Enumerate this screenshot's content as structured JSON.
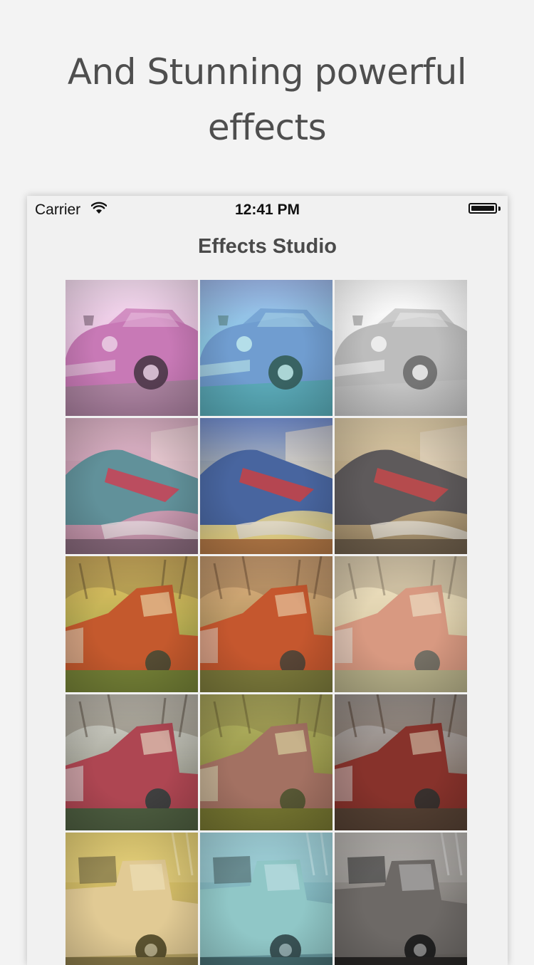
{
  "headline": "And Stunning powerful effects",
  "status_bar": {
    "carrier": "Carrier",
    "time": "12:41 PM",
    "wifi_icon": "wifi-icon",
    "battery_icon": "battery-icon",
    "battery_level": 1.0
  },
  "nav": {
    "title": "Effects Studio"
  },
  "effects": [
    {
      "row": 1,
      "col": 1,
      "subject": "vintage-sedan",
      "bg": [
        "#ffffff",
        "#d8b6d0"
      ],
      "body": "#c27ab0",
      "ground": "#7a6a72",
      "tint": "rgba(220,120,200,0.25)"
    },
    {
      "row": 1,
      "col": 2,
      "subject": "vintage-sedan",
      "bg": [
        "#b7a3e8",
        "#8fe0e6"
      ],
      "body": "#7a7fc7",
      "ground": "#3f6d83",
      "tint": "rgba(90,230,230,0.30)"
    },
    {
      "row": 1,
      "col": 3,
      "subject": "vintage-sedan",
      "bg": [
        "#ffffff",
        "#d3d3d3"
      ],
      "body": "#9a9a9a",
      "ground": "#8a8a8a",
      "tint": "rgba(255,255,255,0.35)"
    },
    {
      "row": 2,
      "col": 1,
      "subject": "tailfin-car",
      "bg": [
        "#caa8b8",
        "#b48a9f"
      ],
      "body": "#3f8a8e",
      "ground": "#6a5664",
      "tint": "rgba(255,180,210,0.18)"
    },
    {
      "row": 2,
      "col": 2,
      "subject": "tailfin-car",
      "bg": [
        "#4c77d9",
        "#f3dd7c"
      ],
      "body": "#2953a6",
      "ground": "#a0663b",
      "tint": "rgba(255,210,120,0.15)"
    },
    {
      "row": 2,
      "col": 3,
      "subject": "tailfin-car",
      "bg": [
        "#d9c9a7",
        "#8f7b5d"
      ],
      "body": "#3b3e4e",
      "ground": "#4e4238",
      "tint": "rgba(220,190,140,0.22)"
    },
    {
      "row": 3,
      "col": 1,
      "subject": "rusty-truck",
      "bg": [
        "#e6c36a",
        "#6d8a3a"
      ],
      "body": "#b63b22",
      "ground": "#4f6a2c",
      "tint": "rgba(255,210,90,0.20)"
    },
    {
      "row": 3,
      "col": 2,
      "subject": "rusty-truck",
      "bg": [
        "#e0b98d",
        "#6a6f3e"
      ],
      "body": "#b5411f",
      "ground": "#556b2f",
      "tint": "rgba(255,170,100,0.22)"
    },
    {
      "row": 3,
      "col": 3,
      "subject": "rusty-truck",
      "bg": [
        "#f0e2c3",
        "#a79a6e"
      ],
      "body": "#c46a57",
      "ground": "#8c8a60",
      "tint": "rgba(255,240,210,0.35)"
    },
    {
      "row": 4,
      "col": 1,
      "subject": "rusty-truck",
      "bg": [
        "#d8d8d0",
        "#6a6a58"
      ],
      "body": "#a5313f",
      "ground": "#384a2a",
      "tint": "rgba(255,255,255,0.10)"
    },
    {
      "row": 4,
      "col": 2,
      "subject": "rusty-truck",
      "bg": [
        "#b4b46f",
        "#5d5a2a"
      ],
      "body": "#95506a",
      "ground": "#545424",
      "tint": "rgba(200,200,80,0.28)"
    },
    {
      "row": 4,
      "col": 3,
      "subject": "rusty-truck",
      "bg": [
        "#bfc7cc",
        "#6c5a4a"
      ],
      "body": "#8a2c28",
      "ground": "#4b3c30",
      "tint": "rgba(120,80,60,0.18)"
    },
    {
      "row": 5,
      "col": 1,
      "subject": "old-pickup",
      "bg": [
        "#d9c56d",
        "#9c8d6b"
      ],
      "body": "#d7c4ab",
      "ground": "#5e5644",
      "tint": "rgba(255,220,80,0.25)"
    },
    {
      "row": 5,
      "col": 2,
      "subject": "old-pickup",
      "bg": [
        "#a6cdd6",
        "#5b7b7f"
      ],
      "body": "#99c0bd",
      "ground": "#344647",
      "tint": "rgba(120,220,230,0.25)"
    },
    {
      "row": 5,
      "col": 3,
      "subject": "old-pickup",
      "bg": [
        "#c8c4bf",
        "#6f6a66"
      ],
      "body": "#7d7875",
      "ground": "#2c2a28",
      "tint": "rgba(0,0,0,0.12)"
    }
  ]
}
